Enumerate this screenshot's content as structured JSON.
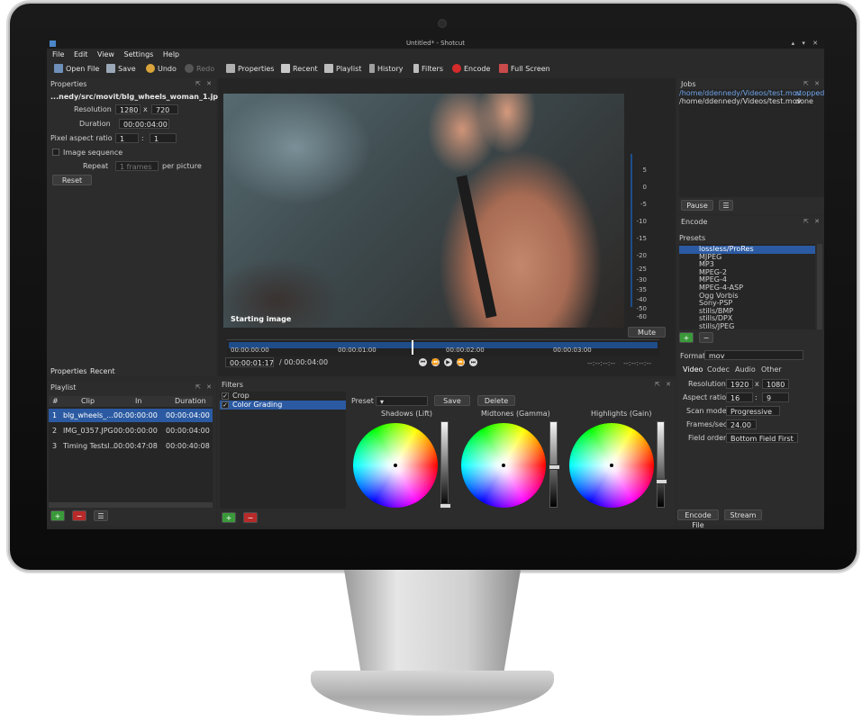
{
  "window": {
    "title": "Untitled* - Shotcut"
  },
  "menu": [
    "File",
    "Edit",
    "View",
    "Settings",
    "Help"
  ],
  "toolbar": {
    "open_file": "Open File",
    "save": "Save",
    "undo": "Undo",
    "redo": "Redo",
    "properties": "Properties",
    "recent": "Recent",
    "playlist": "Playlist",
    "history": "History",
    "filters": "Filters",
    "encode": "Encode",
    "full_screen": "Full Screen"
  },
  "properties": {
    "title": "Properties",
    "file": "...nedy/src/movit/blg_wheels_woman_1.jpg",
    "resolution_label": "Resolution",
    "width": "1280",
    "x": "x",
    "height": "720",
    "duration_label": "Duration",
    "duration": "00:00:04:00",
    "par_label": "Pixel aspect ratio",
    "par_num": "1",
    "colon": ":",
    "par_den": "1",
    "image_sequence": "Image sequence",
    "repeat_label": "Repeat",
    "repeat_value": "1 frames",
    "per_picture": "per picture",
    "reset": "Reset",
    "tab_properties": "Properties",
    "tab_recent": "Recent"
  },
  "playlist": {
    "title": "Playlist",
    "headers": {
      "num": "#",
      "clip": "Clip",
      "in": "In",
      "duration": "Duration"
    },
    "rows": [
      {
        "num": "1",
        "clip": "blg_wheels_...",
        "in": "00:00:00:00",
        "duration": "00:00:04:00"
      },
      {
        "num": "2",
        "clip": "IMG_0357.JPG",
        "in": "00:00:00:00",
        "duration": "00:00:04:00"
      },
      {
        "num": "3",
        "clip": "Timing Testsl...",
        "in": "00:00:47:08",
        "duration": "00:00:40:08"
      }
    ]
  },
  "player": {
    "caption": "Starting image",
    "meter": [
      "5",
      "0",
      "-5",
      "-10",
      "-15",
      "-20",
      "-25",
      "-30",
      "-35",
      "-40",
      "-50",
      "-60"
    ],
    "mute": "Mute",
    "ruler": [
      "00:00:00:00",
      "00:00:01:00",
      "00:00:02:00",
      "00:00:03:00"
    ],
    "position": "00:00:01:17",
    "duration": "/ 00:00:04:00",
    "in_point": "--:--:--:--",
    "out_point": "--:--:--:--"
  },
  "filters": {
    "title": "Filters",
    "items": [
      {
        "label": "Crop",
        "checked": true
      },
      {
        "label": "Color Grading",
        "checked": true
      }
    ],
    "preset_label": "Preset",
    "save": "Save",
    "delete": "Delete",
    "shadows": "Shadows (Lift)",
    "midtones": "Midtones (Gamma)",
    "highlights": "Highlights (Gain)"
  },
  "jobs": {
    "title": "Jobs",
    "rows": [
      {
        "path": "/home/ddennedy/Videos/test.mov",
        "status": "stopped"
      },
      {
        "path": "/home/ddennedy/Videos/test.mov",
        "status": "done"
      }
    ],
    "pause": "Pause"
  },
  "encode": {
    "title": "Encode",
    "presets_label": "Presets",
    "presets": [
      "lossless/ProRes",
      "MJPEG",
      "MP3",
      "MPEG-2",
      "MPEG-4",
      "MPEG-4-ASP",
      "Ogg Vorbis",
      "Sony-PSP",
      "stills/BMP",
      "stills/DPX",
      "stills/JPEG"
    ],
    "format_label": "Format",
    "format": "mov",
    "tabs": [
      "Video",
      "Codec",
      "Audio",
      "Other"
    ],
    "resolution_label": "Resolution",
    "res_w": "1920",
    "x": "x",
    "res_h": "1080",
    "aspect_label": "Aspect ratio",
    "aspect_w": "16",
    "colon": ":",
    "aspect_h": "9",
    "scan_label": "Scan mode",
    "scan": "Progressive",
    "fps_label": "Frames/sec",
    "fps": "24.00",
    "field_label": "Field order",
    "field": "Bottom Field First",
    "encode_file": "Encode File",
    "stream": "Stream"
  },
  "colors": {
    "accent": "#2b5aa2",
    "panel": "#2c2c2c",
    "add": "#3a9a3a",
    "remove": "#c23030"
  }
}
